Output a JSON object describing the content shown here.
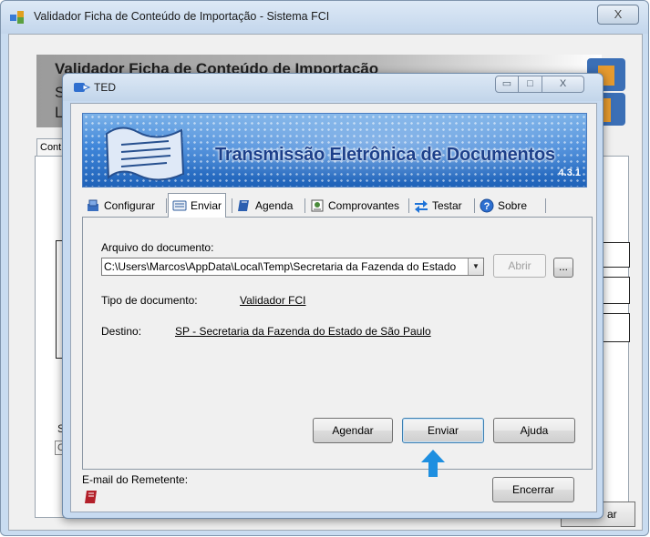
{
  "background_window": {
    "title": "Validador Ficha de Conteúdo de Importação - Sistema FCI",
    "close_label": "X",
    "banner_title": "Validador Ficha de Conteúdo de Importação",
    "banner_line_2": "S",
    "banner_line_3": "L",
    "tab_label": "Cont",
    "side_label": "S",
    "combo_fragment": "C",
    "button_fragment": "ar"
  },
  "ted_dialog": {
    "title": "TED",
    "controls": {
      "minimize": "▭",
      "maximize": "□",
      "close": "X"
    },
    "banner": {
      "title": "Transmissão Eletrônica de Documentos",
      "version": "4.3.1"
    },
    "tabs": [
      {
        "label": "Configurar",
        "icon": "gear-icon"
      },
      {
        "label": "Enviar",
        "icon": "send-icon",
        "active": true
      },
      {
        "label": "Agenda",
        "icon": "agenda-icon"
      },
      {
        "label": "Comprovantes",
        "icon": "receipts-icon"
      },
      {
        "label": "Testar",
        "icon": "test-arrows-icon"
      },
      {
        "label": "Sobre",
        "icon": "help-icon"
      }
    ],
    "enviar": {
      "file_label": "Arquivo do documento:",
      "file_value": "C:\\Users\\Marcos\\AppData\\Local\\Temp\\Secretaria da Fazenda do Estado",
      "open_button": "Abrir",
      "browse_button": "...",
      "doc_type_label": "Tipo de documento:",
      "doc_type_value": "Validador FCI",
      "destination_label": "Destino:",
      "destination_value": "SP - Secretaria da Fazenda do Estado de São Paulo",
      "buttons": {
        "schedule": "Agendar",
        "send": "Enviar",
        "help": "Ajuda"
      }
    },
    "footer": {
      "sender_email_label": "E-mail do Remetente:",
      "close_button": "Encerrar"
    }
  },
  "colors": {
    "banner_blue": "#3f86d9",
    "banner_title": "#1c3f8a",
    "indicator_arrow": "#1e8fe0"
  }
}
